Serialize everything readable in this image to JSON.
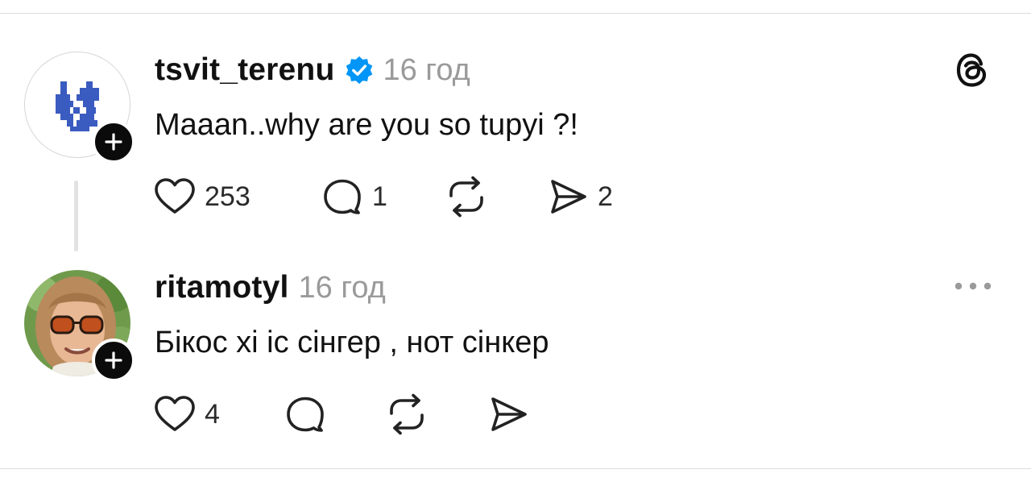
{
  "posts": [
    {
      "username": "tsvit_terenu",
      "verified": true,
      "time": "16 год",
      "text": "Maaan..why are you so tupyi ?!",
      "likes": "253",
      "replies": "1",
      "reposts": "",
      "shares": "2",
      "corner_icon": "threads-logo-icon",
      "avatar": "pixel-logo-icon"
    },
    {
      "username": "ritamotyl",
      "verified": false,
      "time": "16 год",
      "text": "Бікос хі іс сінгер , нот сінкер",
      "likes": "4",
      "replies": "",
      "reposts": "",
      "shares": "",
      "corner_icon": "more-options-icon",
      "avatar": "user-photo"
    }
  ],
  "colors": {
    "text": "#111111",
    "muted": "#9a9a9a",
    "verified": "#0095f6",
    "avatar_logo": "#3a5bbf",
    "divider": "#dcdcdc"
  }
}
